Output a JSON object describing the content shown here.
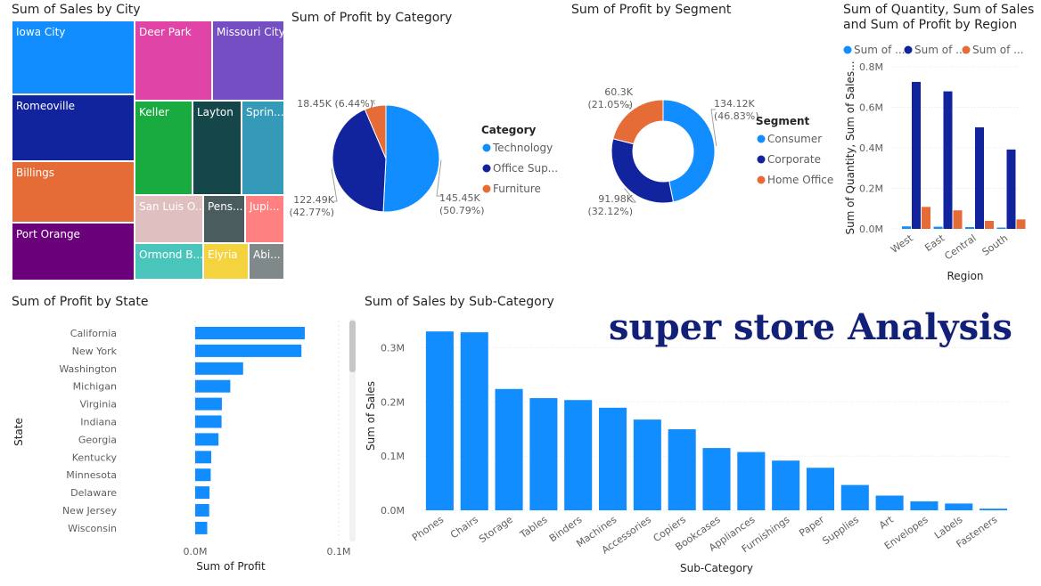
{
  "dashboard_title": "super store Analysis",
  "colors": {
    "blue": "#118DFF",
    "navy": "#12239E",
    "orange": "#E66C37",
    "title": "#122077",
    "grid": "#E6E6E6"
  },
  "chart_data": [
    {
      "id": "sales_by_city",
      "type": "treemap",
      "title": "Sum of Sales by City",
      "cells": [
        {
          "label": "Iowa City",
          "color": "#118DFF"
        },
        {
          "label": "Romeoville",
          "color": "#12239E"
        },
        {
          "label": "Billings",
          "color": "#E66C37"
        },
        {
          "label": "Port Orange",
          "color": "#6B007B"
        },
        {
          "label": "Deer Park",
          "color": "#E044A7"
        },
        {
          "label": "Missouri City",
          "color": "#744EC2"
        },
        {
          "label": "Keller",
          "color": "#1AAB40"
        },
        {
          "label": "Layton",
          "color": "#15474A"
        },
        {
          "label": "Sprin...",
          "color": "#3599B8"
        },
        {
          "label": "San Luis O...",
          "color": "#DFBFBF"
        },
        {
          "label": "Pens...",
          "color": "#4A5C5E"
        },
        {
          "label": "Jupi...",
          "color": "#FF8080"
        },
        {
          "label": "Ormond B...",
          "color": "#4AC5BB"
        },
        {
          "label": "Elyria",
          "color": "#F5D33F"
        },
        {
          "label": "Abi...",
          "color": "#7F898A"
        }
      ]
    },
    {
      "id": "profit_by_category",
      "type": "pie",
      "title": "Sum of Profit by Category",
      "legend_title": "Category",
      "legend_position": "right",
      "slices": [
        {
          "name": "Technology",
          "legend": "Technology",
          "value": 145.45,
          "label": "145.45K",
          "pct": "(50.79%)",
          "color": "#118DFF"
        },
        {
          "name": "Office Supplies",
          "legend": "Office Sup...",
          "value": 122.49,
          "label": "122.49K",
          "pct": "(42.77%)",
          "color": "#12239E"
        },
        {
          "name": "Furniture",
          "legend": "Furniture",
          "value": 18.45,
          "label": "18.45K (6.44%)",
          "pct": "",
          "color": "#E66C37"
        }
      ]
    },
    {
      "id": "profit_by_segment",
      "type": "donut",
      "title": "Sum of Profit by Segment",
      "legend_title": "Segment",
      "legend_position": "right",
      "slices": [
        {
          "name": "Consumer",
          "value": 134.12,
          "label": "134.12K",
          "pct": "(46.83%)",
          "color": "#118DFF"
        },
        {
          "name": "Corporate",
          "value": 91.98,
          "label": "91.98K",
          "pct": "(32.12%)",
          "color": "#12239E"
        },
        {
          "name": "Home Office",
          "value": 60.3,
          "label": "60.3K",
          "pct": "(21.05%)",
          "color": "#E66C37"
        }
      ]
    },
    {
      "id": "region",
      "type": "bar",
      "title_lines": [
        "Sum of Quantity, Sum of Sales",
        "and Sum of Profit by Region"
      ],
      "categories": [
        "West",
        "East",
        "Central",
        "South"
      ],
      "series": [
        {
          "name": "Sum of ...",
          "color": "#118DFF",
          "values": [
            12266,
            10618,
            8780,
            6209
          ]
        },
        {
          "name": "Sum of ...",
          "color": "#12239E",
          "values": [
            725458,
            678781,
            501240,
            391722
          ]
        },
        {
          "name": "Sum of ...",
          "color": "#E66C37",
          "values": [
            108418,
            91523,
            39706,
            46750
          ]
        }
      ],
      "yticks": [
        "0.0M",
        "0.2M",
        "0.4M",
        "0.6M",
        "0.8M"
      ],
      "ylim": [
        0,
        800000
      ],
      "xlabel": "Region",
      "ylabel": "Sum of Quantity, Sum of Sales...",
      "legend_position": "top"
    },
    {
      "id": "profit_by_state",
      "type": "hbar",
      "title": "Sum of Profit by State",
      "categories": [
        "California",
        "New York",
        "Washington",
        "Michigan",
        "Virginia",
        "Indiana",
        "Georgia",
        "Kentucky",
        "Minnesota",
        "Delaware",
        "New Jersey",
        "Wisconsin"
      ],
      "values": [
        76381,
        74039,
        33403,
        24463,
        18598,
        18383,
        16250,
        11200,
        10823,
        9977,
        9773,
        8402
      ],
      "xticks": [
        "0.0M",
        "0.1M"
      ],
      "xlim": [
        0,
        100000
      ],
      "xlabel": "Sum of Profit",
      "ylabel": "State",
      "color": "#118DFF"
    },
    {
      "id": "sales_by_subcategory",
      "type": "bar",
      "title": "Sum of Sales by Sub-Category",
      "categories": [
        "Phones",
        "Chairs",
        "Storage",
        "Tables",
        "Binders",
        "Machines",
        "Accessories",
        "Copiers",
        "Bookcases",
        "Appliances",
        "Furnishings",
        "Paper",
        "Supplies",
        "Art",
        "Envelopes",
        "Labels",
        "Fasteners"
      ],
      "values": [
        330007,
        328449,
        223844,
        206966,
        203413,
        189239,
        167380,
        149528,
        114880,
        107532,
        91705,
        78479,
        46674,
        27119,
        16476,
        12486,
        3024
      ],
      "yticks": [
        "0.0M",
        "0.1M",
        "0.2M",
        "0.3M"
      ],
      "ylim": [
        0,
        350000
      ],
      "xlabel": "Sub-Category",
      "ylabel": "Sum of Sales",
      "color": "#118DFF"
    }
  ]
}
